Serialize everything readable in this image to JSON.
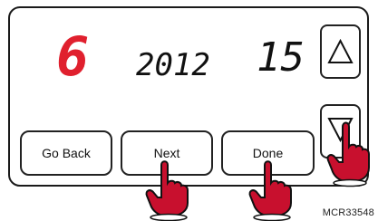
{
  "display": {
    "month": "6",
    "year": "2012",
    "day": "15"
  },
  "buttons": {
    "go_back": "Go Back",
    "next": "Next",
    "done": "Done"
  },
  "arrows": {
    "up_icon": "triangle-up",
    "down_icon": "triangle-down"
  },
  "caption": "MCR33548",
  "colors": {
    "accent_red": "#e0202e",
    "hand_red": "#c8102e"
  }
}
